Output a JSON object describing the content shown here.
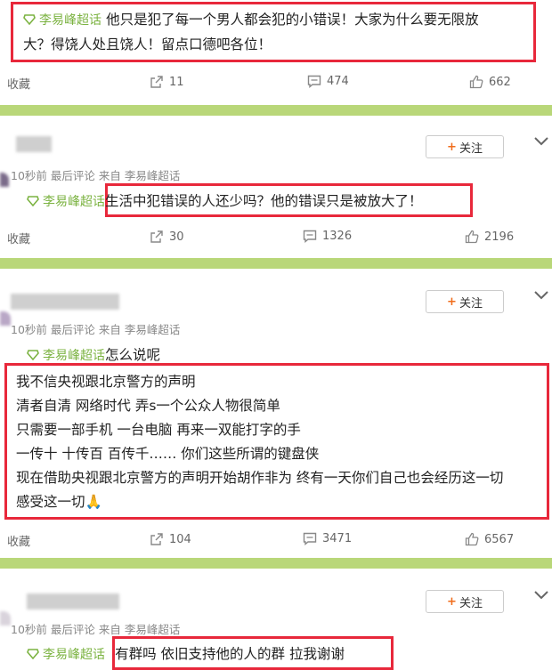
{
  "topic_name": "李易峰超话",
  "follow_label": "关注",
  "collect_label": "收藏",
  "meta": {
    "time": "10秒前",
    "last_comment": "最后评论",
    "from": "来自",
    "source": "李易峰超话"
  },
  "posts": [
    {
      "lines": [
        "他只是犯了每一个男人都会犯的小错误！大家为什么要无限放",
        "大？得饶人处且饶人！留点口德吧各位！"
      ],
      "shares": "11",
      "comments": "474",
      "likes": "662"
    },
    {
      "lines": [
        "生活中犯错误的人还少吗？他的错误只是被放大了！"
      ],
      "shares": "30",
      "comments": "1326",
      "likes": "2196"
    },
    {
      "topic_suffix": "怎么说呢",
      "lines": [
        "我不信央视跟北京警方的声明",
        "清者自清 网络时代 弄s一个公众人物很简单",
        "只需要一部手机 一台电脑 再来一双能打字的手",
        "一传十 十传百 百传千…… 你们这些所谓的键盘侠",
        "现在借助央视跟北京警方的声明开始胡作非为 终有一天你们自己也会经历这一切",
        "感受这一切"
      ],
      "emoji": "🙏",
      "shares": "104",
      "comments": "3471",
      "likes": "6567"
    },
    {
      "lines": [
        "有群吗 依旧支持他的人的群 拉我谢谢"
      ]
    }
  ]
}
